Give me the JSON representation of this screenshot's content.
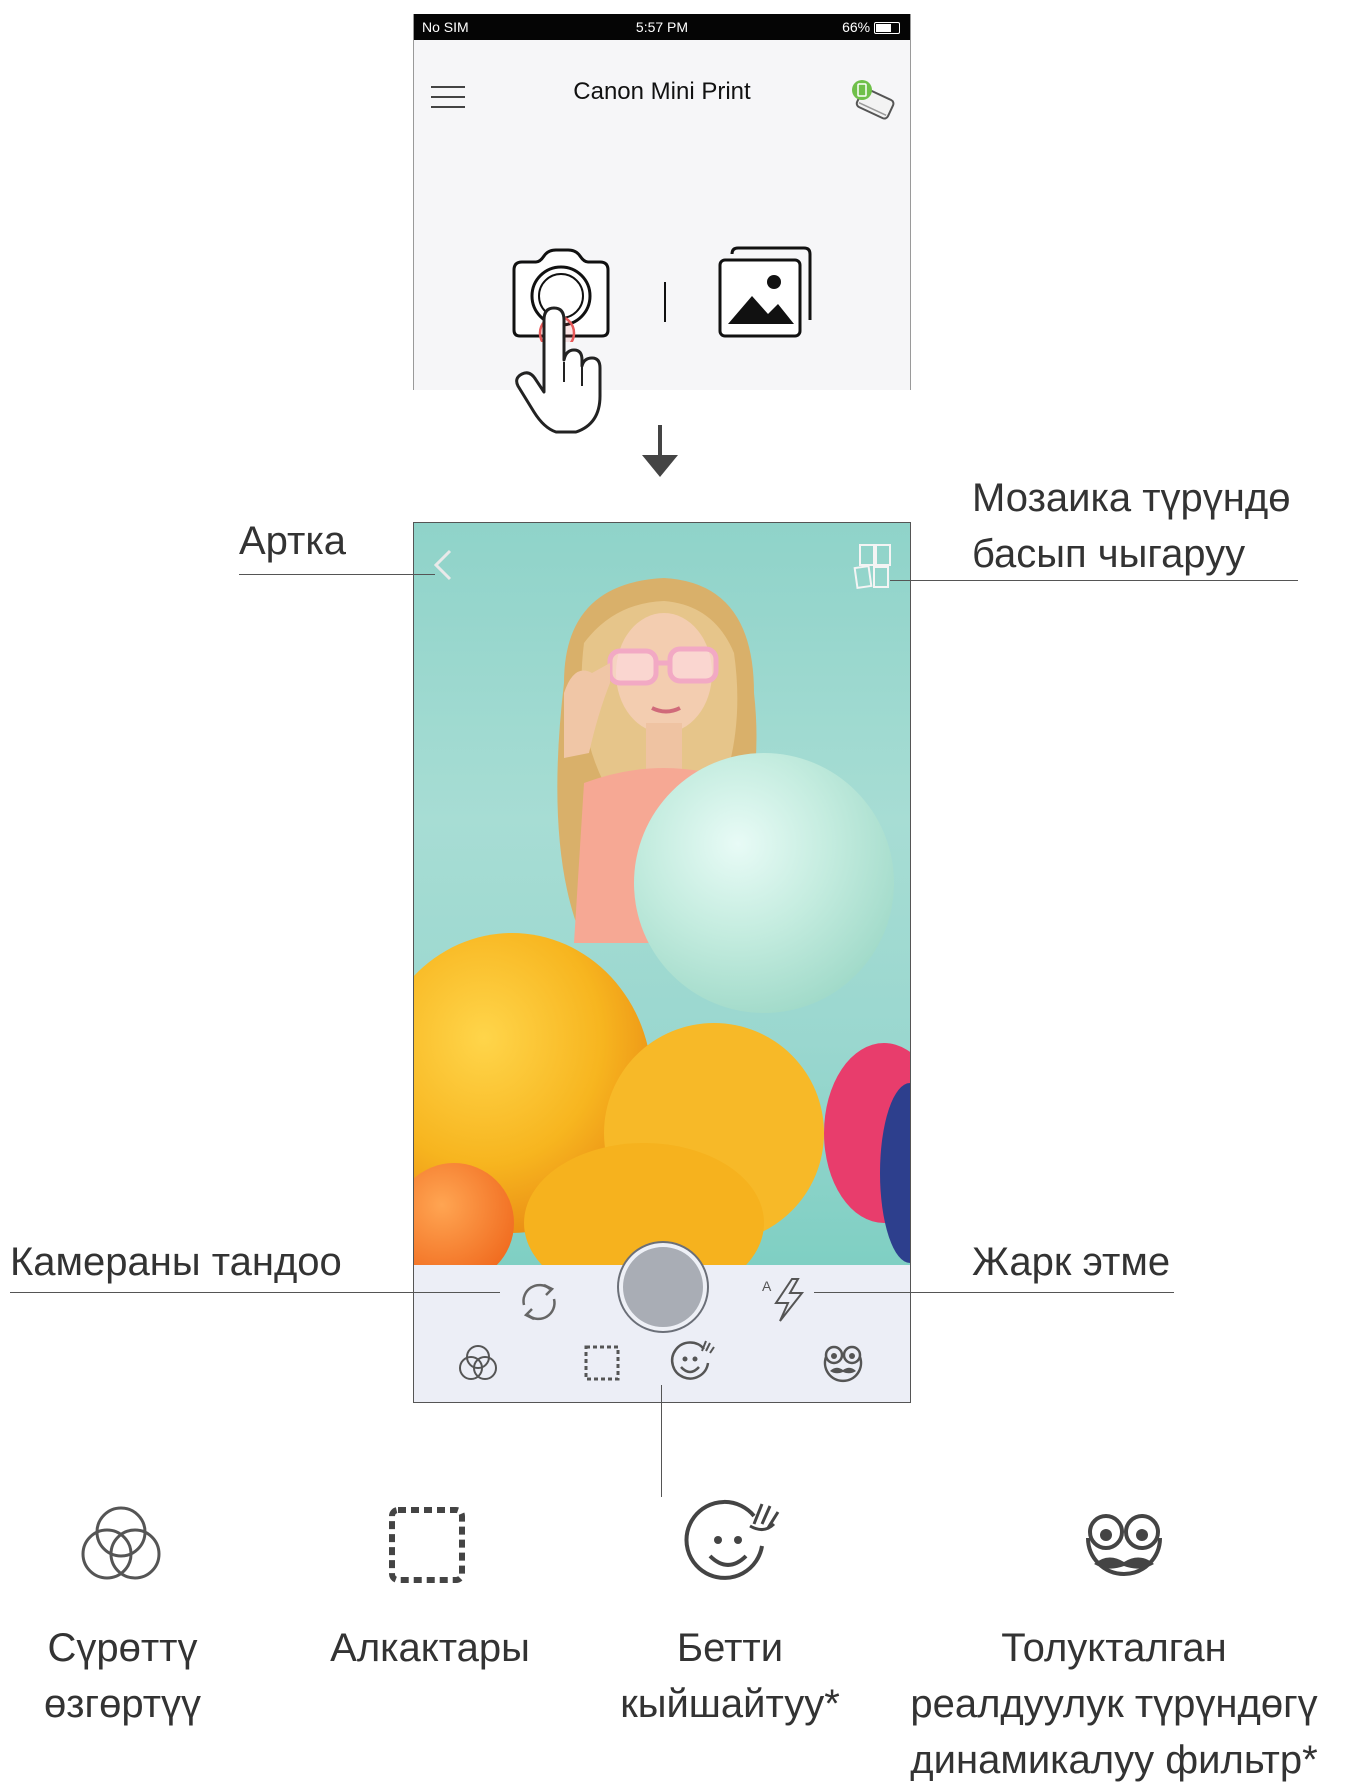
{
  "status_bar": {
    "carrier": "No SIM",
    "time": "5:57 PM",
    "battery": "66%"
  },
  "app": {
    "title": "Canon Mini Print"
  },
  "callouts": {
    "back": "Артка",
    "mosaic_line1": "Мозаика түрүндө",
    "mosaic_line2": "басып чыгаруу",
    "camera_select": "Камераны тандоо",
    "flash": "Жарк этме"
  },
  "features": [
    {
      "line1": "Сүрөттү",
      "line2": "өзгөртүү",
      "line3": "",
      "icon": "filters-icon"
    },
    {
      "line1": "Алкактары",
      "line2": "",
      "line3": "",
      "icon": "frames-icon"
    },
    {
      "line1": "Бетти",
      "line2": "кыйшайтуу*",
      "line3": "",
      "icon": "face-warp-icon"
    },
    {
      "line1": "Толукталган",
      "line2": "реалдуулук түрүндөгү",
      "line3": "динамикалуу фильтр*",
      "icon": "ar-filter-icon"
    }
  ]
}
